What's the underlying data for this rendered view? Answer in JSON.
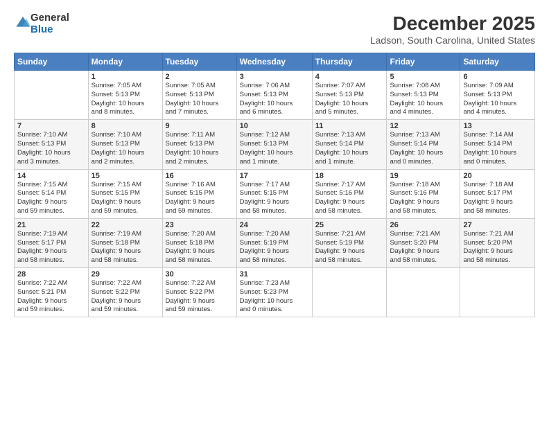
{
  "header": {
    "logo_general": "General",
    "logo_blue": "Blue",
    "month_title": "December 2025",
    "location": "Ladson, South Carolina, United States"
  },
  "days_of_week": [
    "Sunday",
    "Monday",
    "Tuesday",
    "Wednesday",
    "Thursday",
    "Friday",
    "Saturday"
  ],
  "weeks": [
    [
      {
        "day": "",
        "info": ""
      },
      {
        "day": "1",
        "info": "Sunrise: 7:05 AM\nSunset: 5:13 PM\nDaylight: 10 hours\nand 8 minutes."
      },
      {
        "day": "2",
        "info": "Sunrise: 7:05 AM\nSunset: 5:13 PM\nDaylight: 10 hours\nand 7 minutes."
      },
      {
        "day": "3",
        "info": "Sunrise: 7:06 AM\nSunset: 5:13 PM\nDaylight: 10 hours\nand 6 minutes."
      },
      {
        "day": "4",
        "info": "Sunrise: 7:07 AM\nSunset: 5:13 PM\nDaylight: 10 hours\nand 5 minutes."
      },
      {
        "day": "5",
        "info": "Sunrise: 7:08 AM\nSunset: 5:13 PM\nDaylight: 10 hours\nand 4 minutes."
      },
      {
        "day": "6",
        "info": "Sunrise: 7:09 AM\nSunset: 5:13 PM\nDaylight: 10 hours\nand 4 minutes."
      }
    ],
    [
      {
        "day": "7",
        "info": "Sunrise: 7:10 AM\nSunset: 5:13 PM\nDaylight: 10 hours\nand 3 minutes."
      },
      {
        "day": "8",
        "info": "Sunrise: 7:10 AM\nSunset: 5:13 PM\nDaylight: 10 hours\nand 2 minutes."
      },
      {
        "day": "9",
        "info": "Sunrise: 7:11 AM\nSunset: 5:13 PM\nDaylight: 10 hours\nand 2 minutes."
      },
      {
        "day": "10",
        "info": "Sunrise: 7:12 AM\nSunset: 5:13 PM\nDaylight: 10 hours\nand 1 minute."
      },
      {
        "day": "11",
        "info": "Sunrise: 7:13 AM\nSunset: 5:14 PM\nDaylight: 10 hours\nand 1 minute."
      },
      {
        "day": "12",
        "info": "Sunrise: 7:13 AM\nSunset: 5:14 PM\nDaylight: 10 hours\nand 0 minutes."
      },
      {
        "day": "13",
        "info": "Sunrise: 7:14 AM\nSunset: 5:14 PM\nDaylight: 10 hours\nand 0 minutes."
      }
    ],
    [
      {
        "day": "14",
        "info": "Sunrise: 7:15 AM\nSunset: 5:14 PM\nDaylight: 9 hours\nand 59 minutes."
      },
      {
        "day": "15",
        "info": "Sunrise: 7:15 AM\nSunset: 5:15 PM\nDaylight: 9 hours\nand 59 minutes."
      },
      {
        "day": "16",
        "info": "Sunrise: 7:16 AM\nSunset: 5:15 PM\nDaylight: 9 hours\nand 59 minutes."
      },
      {
        "day": "17",
        "info": "Sunrise: 7:17 AM\nSunset: 5:15 PM\nDaylight: 9 hours\nand 58 minutes."
      },
      {
        "day": "18",
        "info": "Sunrise: 7:17 AM\nSunset: 5:16 PM\nDaylight: 9 hours\nand 58 minutes."
      },
      {
        "day": "19",
        "info": "Sunrise: 7:18 AM\nSunset: 5:16 PM\nDaylight: 9 hours\nand 58 minutes."
      },
      {
        "day": "20",
        "info": "Sunrise: 7:18 AM\nSunset: 5:17 PM\nDaylight: 9 hours\nand 58 minutes."
      }
    ],
    [
      {
        "day": "21",
        "info": "Sunrise: 7:19 AM\nSunset: 5:17 PM\nDaylight: 9 hours\nand 58 minutes."
      },
      {
        "day": "22",
        "info": "Sunrise: 7:19 AM\nSunset: 5:18 PM\nDaylight: 9 hours\nand 58 minutes."
      },
      {
        "day": "23",
        "info": "Sunrise: 7:20 AM\nSunset: 5:18 PM\nDaylight: 9 hours\nand 58 minutes."
      },
      {
        "day": "24",
        "info": "Sunrise: 7:20 AM\nSunset: 5:19 PM\nDaylight: 9 hours\nand 58 minutes."
      },
      {
        "day": "25",
        "info": "Sunrise: 7:21 AM\nSunset: 5:19 PM\nDaylight: 9 hours\nand 58 minutes."
      },
      {
        "day": "26",
        "info": "Sunrise: 7:21 AM\nSunset: 5:20 PM\nDaylight: 9 hours\nand 58 minutes."
      },
      {
        "day": "27",
        "info": "Sunrise: 7:21 AM\nSunset: 5:20 PM\nDaylight: 9 hours\nand 58 minutes."
      }
    ],
    [
      {
        "day": "28",
        "info": "Sunrise: 7:22 AM\nSunset: 5:21 PM\nDaylight: 9 hours\nand 59 minutes."
      },
      {
        "day": "29",
        "info": "Sunrise: 7:22 AM\nSunset: 5:22 PM\nDaylight: 9 hours\nand 59 minutes."
      },
      {
        "day": "30",
        "info": "Sunrise: 7:22 AM\nSunset: 5:22 PM\nDaylight: 9 hours\nand 59 minutes."
      },
      {
        "day": "31",
        "info": "Sunrise: 7:23 AM\nSunset: 5:23 PM\nDaylight: 10 hours\nand 0 minutes."
      },
      {
        "day": "",
        "info": ""
      },
      {
        "day": "",
        "info": ""
      },
      {
        "day": "",
        "info": ""
      }
    ]
  ]
}
